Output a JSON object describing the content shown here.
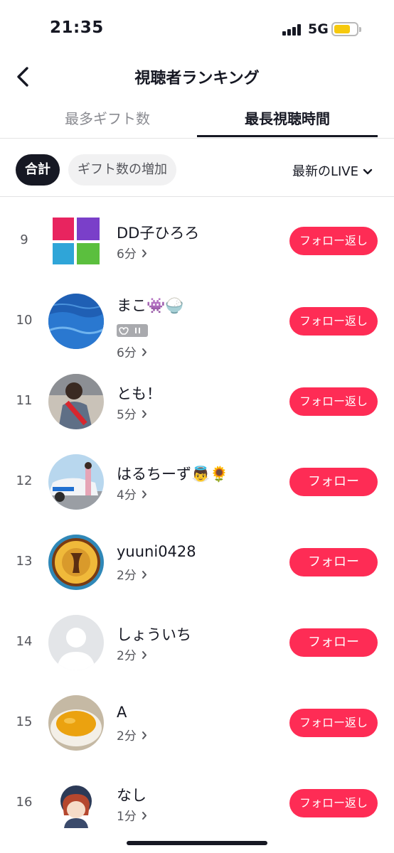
{
  "status_bar": {
    "time": "21:35",
    "network": "5G",
    "battery_color": "#f6c90e"
  },
  "header": {
    "title": "視聴者ランキング",
    "back_icon": "chevron-left-icon"
  },
  "tabs": [
    {
      "label": "最多ギフト数",
      "selected": false
    },
    {
      "label": "最長視聴時間",
      "selected": true
    }
  ],
  "filters": {
    "chips": [
      {
        "label": "合計",
        "selected": true
      },
      {
        "label": "ギフト数の増加",
        "selected": false
      }
    ],
    "sort": {
      "label": "最新のLIVE",
      "icon": "chevron-down-icon"
    }
  },
  "colors": {
    "accent": "#fe2c55",
    "text": "#161823",
    "secondary": "#8a8b91"
  },
  "viewers": [
    {
      "rank": "9",
      "name": "DD子ひろろ",
      "minutes": "6分",
      "button": "フォロー返し",
      "avatar": "text-logo-avatar"
    },
    {
      "rank": "10",
      "name": "まこ👾🍚",
      "minutes": "6分",
      "button": "フォロー返し",
      "avatar": "pool-water-avatar",
      "has_badge": true
    },
    {
      "rank": "11",
      "name": "とも！",
      "minutes": "5分",
      "button": "フォロー返し",
      "avatar": "person-photo-avatar"
    },
    {
      "rank": "12",
      "name": "はるちーず👼🌻",
      "minutes": "4分",
      "button": "フォロー",
      "avatar": "car-photo-avatar"
    },
    {
      "rank": "13",
      "name": "yuuni0428",
      "minutes": "2分",
      "button": "フォロー",
      "avatar": "hula-school-logo-avatar"
    },
    {
      "rank": "14",
      "name": "しょういち",
      "minutes": "2分",
      "button": "フォロー",
      "avatar": "default-person-avatar"
    },
    {
      "rank": "15",
      "name": "A",
      "minutes": "2分",
      "button": "フォロー返し",
      "avatar": "soup-bowl-avatar"
    },
    {
      "rank": "16",
      "name": "なし",
      "minutes": "1分",
      "button": "フォロー返し",
      "avatar": "cartoon-character-avatar"
    }
  ]
}
